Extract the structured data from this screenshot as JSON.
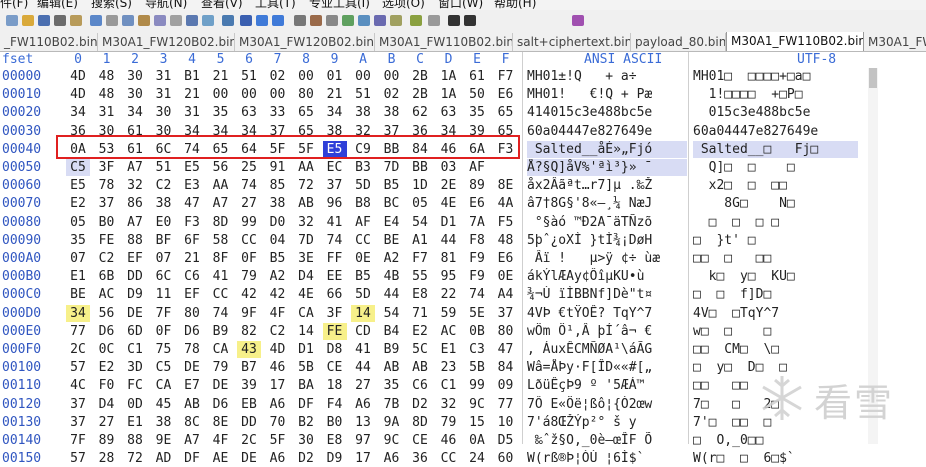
{
  "menu": [
    "件(F)",
    "编辑(E)",
    "搜索(S)",
    "导航(N)",
    "查看(V)",
    "工具(T)",
    "专业工具(I)",
    "选项(O)",
    "窗口(W)",
    "帮助(H)"
  ],
  "tabs": [
    {
      "label": "_FW110B02.bin",
      "active": false
    },
    {
      "label": "M30A1_FW120B02.bin",
      "active": false
    },
    {
      "label": "M30A1_FW120B02.bin",
      "active": false
    },
    {
      "label": "M30A1_FW110B02.bin",
      "active": false
    },
    {
      "label": "salt+ciphertext.bin",
      "active": false
    },
    {
      "label": "payload_80.bin",
      "active": false
    },
    {
      "label": "M30A1_FW110B02.bin",
      "active": true
    },
    {
      "label": "M30A1_FW",
      "active": false
    }
  ],
  "header": {
    "offset_label": "fset",
    "columns": [
      "0",
      "1",
      "2",
      "3",
      "4",
      "5",
      "6",
      "7",
      "8",
      "9",
      "A",
      "B",
      "C",
      "D",
      "E",
      "F"
    ],
    "ascii_label": "ANSI ASCII",
    "utf_label": "UTF-8"
  },
  "rows": [
    {
      "off": "00000",
      "hex": [
        "4D",
        "48",
        "30",
        "31",
        "B1",
        "21",
        "51",
        "02",
        "00",
        "01",
        "00",
        "00",
        "2B",
        "1A",
        "61",
        "F7"
      ],
      "asc": "MH01±!Q   + a÷",
      "utf": "MH01□  □□□□+□a□"
    },
    {
      "off": "00010",
      "hex": [
        "4D",
        "48",
        "30",
        "31",
        "21",
        "00",
        "00",
        "00",
        "80",
        "21",
        "51",
        "02",
        "2B",
        "1A",
        "50",
        "E6"
      ],
      "asc": "MH01!   €!Q + Pæ",
      "utf": "  1!□□□□  +□P□"
    },
    {
      "off": "00020",
      "hex": [
        "34",
        "31",
        "34",
        "30",
        "31",
        "35",
        "63",
        "33",
        "65",
        "34",
        "38",
        "38",
        "62",
        "63",
        "35",
        "65"
      ],
      "asc": "414015c3e488bc5e",
      "utf": "  015c3e488bc5e"
    },
    {
      "off": "00030",
      "hex": [
        "36",
        "30",
        "61",
        "30",
        "34",
        "34",
        "34",
        "37",
        "65",
        "38",
        "32",
        "37",
        "36",
        "34",
        "39",
        "65"
      ],
      "asc": "60a04447e827649e",
      "utf": "60a04447e827649e"
    },
    {
      "off": "00040",
      "hex": [
        "0A",
        "53",
        "61",
        "6C",
        "74",
        "65",
        "64",
        "5F",
        "5F",
        "E5",
        "C9",
        "BB",
        "84",
        "46",
        "6A",
        "F3"
      ],
      "asc": " Salted__åÉ»„Fjó",
      "utf": " Salted__□   Fj□"
    },
    {
      "off": "00050",
      "hex": [
        "C5",
        "3F",
        "A7",
        "51",
        "E5",
        "56",
        "25",
        "91",
        "AA",
        "EC",
        "B3",
        "7D",
        "BB",
        "03",
        "AF",
        "  "
      ],
      "asc": "Å?§Q]åV%'ªì³}» ¯",
      "utf": "  Q]□  □    □"
    },
    {
      "off": "00060",
      "hex": [
        "E5",
        "78",
        "32",
        "C2",
        "E3",
        "AA",
        "74",
        "85",
        "72",
        "37",
        "5D",
        "B5",
        "1D",
        "2E",
        "89",
        "8E"
      ],
      "asc": "åx2Âãªt…r7]µ .‰Ž",
      "utf": "  x2□  □  □□"
    },
    {
      "off": "00070",
      "hex": [
        "E2",
        "37",
        "86",
        "38",
        "47",
        "A7",
        "27",
        "38",
        "AB",
        "96",
        "B8",
        "BC",
        "05",
        "4E",
        "E6",
        "4A"
      ],
      "asc": "â7†8G§'8«–¸¼ NæJ",
      "utf": "    8G□    N□"
    },
    {
      "off": "00080",
      "hex": [
        "05",
        "B0",
        "A7",
        "E0",
        "F3",
        "8D",
        "99",
        "D0",
        "32",
        "41",
        "AF",
        "E4",
        "54",
        "D1",
        "7A",
        "F5"
      ],
      "asc": " °§àó ™Ð2A¯äTÑzõ",
      "utf": "  □  □  □ □"
    },
    {
      "off": "00090",
      "hex": [
        "35",
        "FE",
        "88",
        "BF",
        "6F",
        "58",
        "CC",
        "04",
        "7D",
        "74",
        "CC",
        "BE",
        "A1",
        "44",
        "F8",
        "48"
      ],
      "asc": "5þˆ¿oXÌ }tÌ¾¡DøH",
      "utf": "□  }t' □"
    },
    {
      "off": "000A0",
      "hex": [
        "07",
        "C2",
        "EF",
        "07",
        "21",
        "8F",
        "0F",
        "B5",
        "3E",
        "FF",
        "0E",
        "A2",
        "F7",
        "81",
        "F9",
        "E6"
      ],
      "asc": " Âï !   µ>ÿ ¢÷ ùæ",
      "utf": "□□  □   □□"
    },
    {
      "off": "000B0",
      "hex": [
        "E1",
        "6B",
        "DD",
        "6C",
        "C6",
        "41",
        "79",
        "A2",
        "D4",
        "EE",
        "B5",
        "4B",
        "55",
        "95",
        "F9",
        "0E"
      ],
      "asc": "ákÝlÆAy¢ÔîµKU•ù ",
      "utf": "  k□  y□  KU□"
    },
    {
      "off": "000C0",
      "hex": [
        "BE",
        "AC",
        "D9",
        "11",
        "EF",
        "CC",
        "42",
        "42",
        "4E",
        "66",
        "5D",
        "44",
        "E8",
        "22",
        "74",
        "A4"
      ],
      "asc": "¾¬Ù ïÌBBNf]Dè\"t¤",
      "utf": "□  □  f]D□"
    },
    {
      "off": "000D0",
      "hex": [
        "34",
        "56",
        "DE",
        "7F",
        "80",
        "74",
        "9F",
        "4F",
        "CA",
        "3F",
        "14",
        "54",
        "71",
        "59",
        "5E",
        "37"
      ],
      "asc": "4VÞ €tŸOÊ? TqY^7",
      "utf": "4V□  □TqY^7"
    },
    {
      "off": "000E0",
      "hex": [
        "77",
        "D6",
        "6D",
        "0F",
        "D6",
        "B9",
        "82",
        "C2",
        "14",
        "FE",
        "CD",
        "B4",
        "E2",
        "AC",
        "0B",
        "80"
      ],
      "asc": "wÖm Ö¹‚Â þÍ´â¬ €",
      "utf": "w□  □    □"
    },
    {
      "off": "000F0",
      "hex": [
        "2C",
        "0C",
        "C1",
        "75",
        "78",
        "CA",
        "43",
        "4D",
        "D1",
        "D8",
        "41",
        "B9",
        "5C",
        "E1",
        "C3",
        "47"
      ],
      "asc": ", ÁuxÊCMÑØA¹\\áÃG",
      "utf": "□□  CM□  \\□"
    },
    {
      "off": "00100",
      "hex": [
        "57",
        "E2",
        "3D",
        "C5",
        "DE",
        "79",
        "B7",
        "46",
        "5B",
        "CE",
        "44",
        "AB",
        "AB",
        "23",
        "5B",
        "84"
      ],
      "asc": "Wâ=ÅÞy·F[ÎD««#[„",
      "utf": "□  y□  D□  □"
    },
    {
      "off": "00110",
      "hex": [
        "4C",
        "F0",
        "FC",
        "CA",
        "E7",
        "DE",
        "39",
        "17",
        "BA",
        "18",
        "27",
        "35",
        "C6",
        "C1",
        "99",
        "09"
      ],
      "asc": "LðüÊçÞ9 º '5ÆÁ™ ",
      "utf": "□□   □□"
    },
    {
      "off": "00120",
      "hex": [
        "37",
        "D4",
        "0D",
        "45",
        "AB",
        "D6",
        "EB",
        "A6",
        "DF",
        "F4",
        "A6",
        "7B",
        "D2",
        "32",
        "9C",
        "77"
      ],
      "asc": "7Ô E«Öë¦ßô¦{Ò2œw",
      "utf": "7□   □   2□"
    },
    {
      "off": "00130",
      "hex": [
        "37",
        "27",
        "E1",
        "38",
        "8C",
        "8E",
        "DD",
        "70",
        "B2",
        "B0",
        "13",
        "9A",
        "8D",
        "79",
        "15",
        "10"
      ],
      "asc": "7'á8ŒŽÝp²° š y  ",
      "utf": "7'□  □□  □"
    },
    {
      "off": "00140",
      "hex": [
        "7F",
        "89",
        "88",
        "9E",
        "A7",
        "4F",
        "2C",
        "5F",
        "30",
        "E8",
        "97",
        "9C",
        "CE",
        "46",
        "0A",
        "D5"
      ],
      "asc": " ‰ˆž§O,_0è—œÎF Õ",
      "utf": "□  O,_0□□"
    },
    {
      "off": "00150",
      "hex": [
        "57",
        "28",
        "72",
        "AD",
        "DF",
        "AE",
        "DE",
        "A6",
        "D2",
        "D9",
        "17",
        "A6",
        "36",
        "CC",
        "24",
        "60"
      ],
      "asc": "W(r­ß®Þ¦ÒÙ ¦6Ì$`",
      "utf": "W(r□  □  6□$`"
    }
  ],
  "highlights": {
    "yellow": [
      "00D0:0",
      "00D0:10",
      "00E0:9",
      "00F0:6"
    ],
    "selected_cell": "0040:9",
    "continued_cell": "0050:0"
  },
  "colors": {
    "offset_blue": "#2f55c0",
    "header_blue": "#3a6bd6",
    "selection": "#2f3fd8",
    "highlight": "#f7f08a",
    "box": "#e02020"
  },
  "watermark": {
    "text": "看雪",
    "icon": "snowflake-icon"
  }
}
